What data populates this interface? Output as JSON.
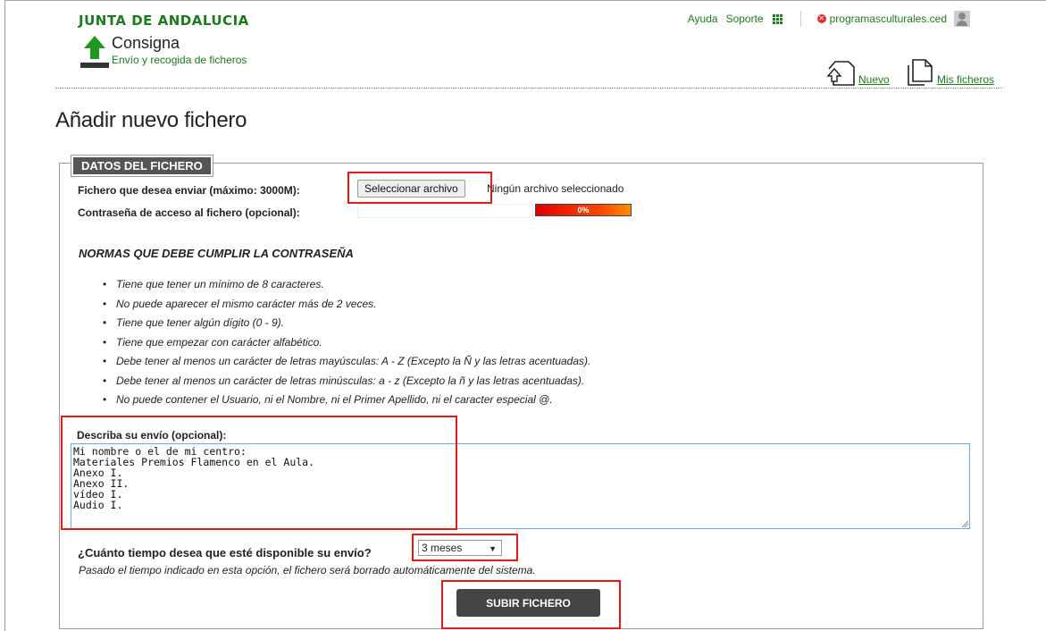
{
  "header": {
    "brand": "JUNTA DE ANDALUCIA",
    "app_name": "Consigna",
    "app_subtitle": "Envío y recogida de ficheros",
    "help": "Ayuda",
    "support": "Soporte",
    "user": "programasculturales.ced",
    "nav_new": "Nuevo",
    "nav_my_files": "Mis ficheros",
    "brand_color": "#1e7a1e"
  },
  "page": {
    "title": "Añadir nuevo fichero"
  },
  "form": {
    "legend": "DATOS DEL FICHERO",
    "file_label": "Fichero que desea enviar (máximo: 3000M):",
    "file_button": "Seleccionar archivo",
    "file_status": "Ningún archivo seleccionado",
    "password_label": "Contraseña de acceso al fichero (opcional):",
    "password_value": "",
    "strength": "0%",
    "rules_title": "NORMAS QUE DEBE CUMPLIR LA CONTRASEÑA",
    "rules": [
      "Tiene que tener un mínimo de 8 caracteres.",
      "No puede aparecer el mismo carácter más de 2 veces.",
      "Tiene que tener algún dígito (0 - 9).",
      "Tiene que empezar con carácter alfabético.",
      "Debe tener al menos un carácter de letras mayúsculas: A - Z (Excepto la Ñ y las letras acentuadas).",
      "Debe tener al menos un carácter de letras minúsculas: a - z (Excepto la ñ y las letras acentuadas).",
      "No puede contener el Usuario, ni el Nombre, ni el Primer Apellido, ni el caracter especial @."
    ],
    "description_label": "Describa su envío (opcional):",
    "description_value": "Mi nombre o el de mi centro:\nMateriales Premios Flamenco en el Aula.\nAnexo I.\nAnexo II.\nvídeo I.\nAudio I.",
    "time_label": "¿Cuánto tiempo desea que esté disponible su envío?",
    "time_selected": "3 meses",
    "time_note": "Pasado el tiempo indicado en esta opción, el fichero será borrado automáticamente del sistema.",
    "submit": "SUBIR FICHERO"
  }
}
